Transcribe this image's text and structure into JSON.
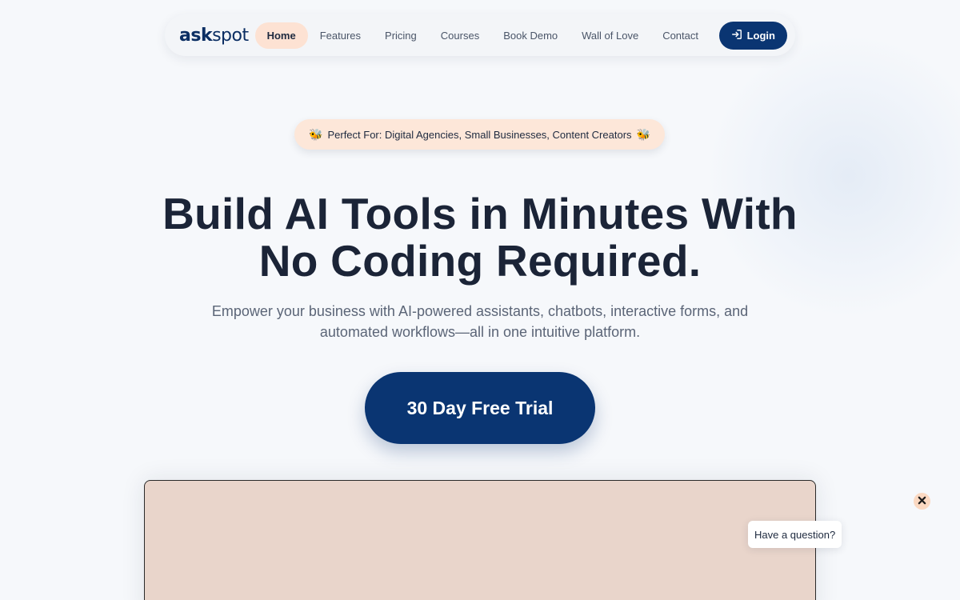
{
  "nav": {
    "logo_ask": "ask",
    "logo_spot": "spot",
    "items": [
      {
        "label": "Home",
        "active": true
      },
      {
        "label": "Features"
      },
      {
        "label": "Pricing"
      },
      {
        "label": "Courses"
      },
      {
        "label": "Book Demo"
      },
      {
        "label": "Wall of Love"
      },
      {
        "label": "Contact"
      }
    ],
    "login_label": "Login"
  },
  "badge": {
    "text": "Perfect For: Digital Agencies, Small Businesses, Content Creators",
    "icon": "bee-icon"
  },
  "hero": {
    "headline_line1": "Build AI Tools in Minutes With",
    "headline_line2": "No Coding Required.",
    "subtext_line1": "Empower your business with AI-powered assistants, chatbots, interactive forms, and",
    "subtext_line2": "automated workflows—all in one intuitive platform.",
    "cta_label": "30 Day Free Trial"
  },
  "chat": {
    "bubble_text": "Have a question?",
    "close_icon": "close-icon"
  },
  "colors": {
    "primary": "#0a3572",
    "accent_peach": "#fde2d3",
    "media_bg": "#e9d5cb",
    "page_bg": "#f6f8fb"
  }
}
